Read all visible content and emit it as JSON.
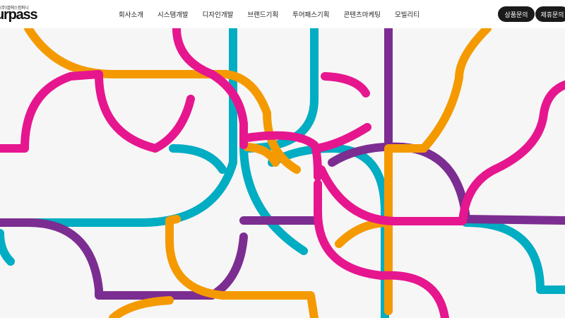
{
  "brand": {
    "small_text": "(주)엘에스컴퍼니",
    "logo_text": "urpass"
  },
  "nav": {
    "items": [
      "회사소개",
      "시스템개발",
      "디자인개발",
      "브랜드기획",
      "투어패스기획",
      "콘텐츠마케팅",
      "모빌리티"
    ]
  },
  "actions": {
    "product_inquiry": "상품문의",
    "partner_inquiry": "제휴문의"
  },
  "colors": {
    "pink": "#e6168f",
    "orange": "#f49a00",
    "teal": "#00adc2",
    "purple": "#7c2d91",
    "header_bg": "#ffffff",
    "button_bg": "#1a1a1a",
    "hero_bg": "#f6f6f6"
  }
}
